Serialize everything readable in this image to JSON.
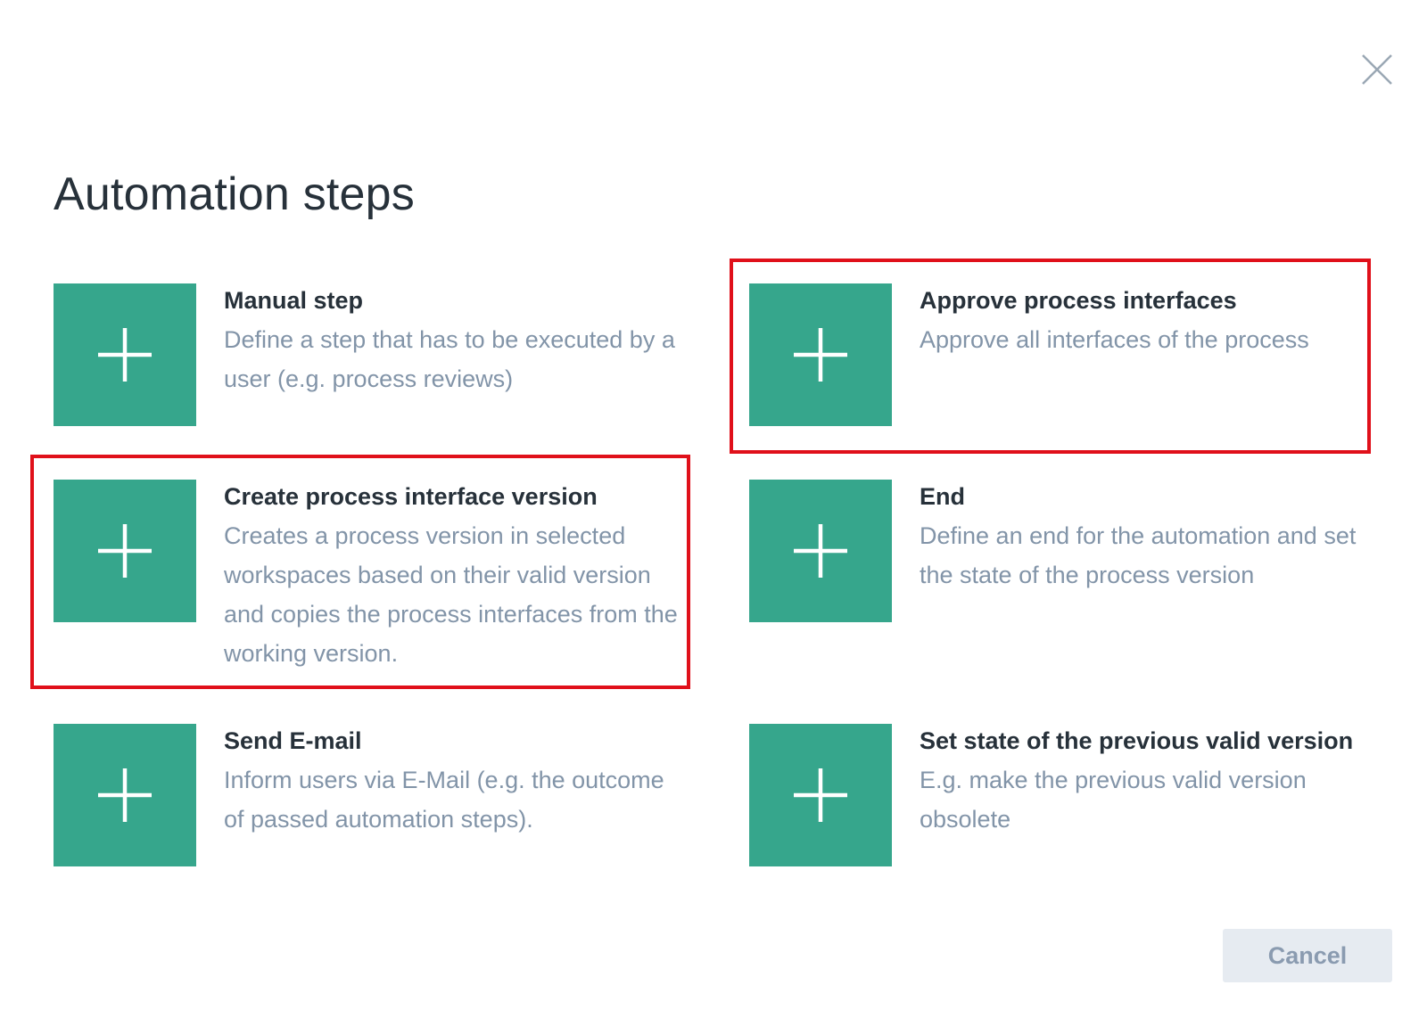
{
  "dialog": {
    "title": "Automation steps",
    "close_icon": "close-icon",
    "cancel_label": "Cancel"
  },
  "colors": {
    "tile": "#36a68c",
    "title_text": "#27313a",
    "description_text": "#8294a8",
    "highlight_border": "#e0101a",
    "cancel_bg": "#e6ebf1"
  },
  "steps": [
    {
      "icon": "plus-icon",
      "name": "Manual step",
      "description": "Define a step that has to be executed by a user (e.g. process reviews)",
      "highlighted": false
    },
    {
      "icon": "plus-icon",
      "name": "Approve process interfaces",
      "description": "Approve all interfaces of the process",
      "highlighted": true
    },
    {
      "icon": "plus-icon",
      "name": "Create process interface version",
      "description": "Creates a process version in selected workspaces based on their valid version and copies the process interfaces from the working version.",
      "highlighted": true
    },
    {
      "icon": "plus-icon",
      "name": "End",
      "description": "Define an end for the automation and set the state of the process version",
      "highlighted": false
    },
    {
      "icon": "plus-icon",
      "name": "Send E-mail",
      "description": "Inform users via E-Mail (e.g. the outcome of passed automation steps).",
      "highlighted": false
    },
    {
      "icon": "plus-icon",
      "name": "Set state of the previous valid version",
      "description": "E.g. make the previous valid version obsolete",
      "highlighted": false
    }
  ]
}
